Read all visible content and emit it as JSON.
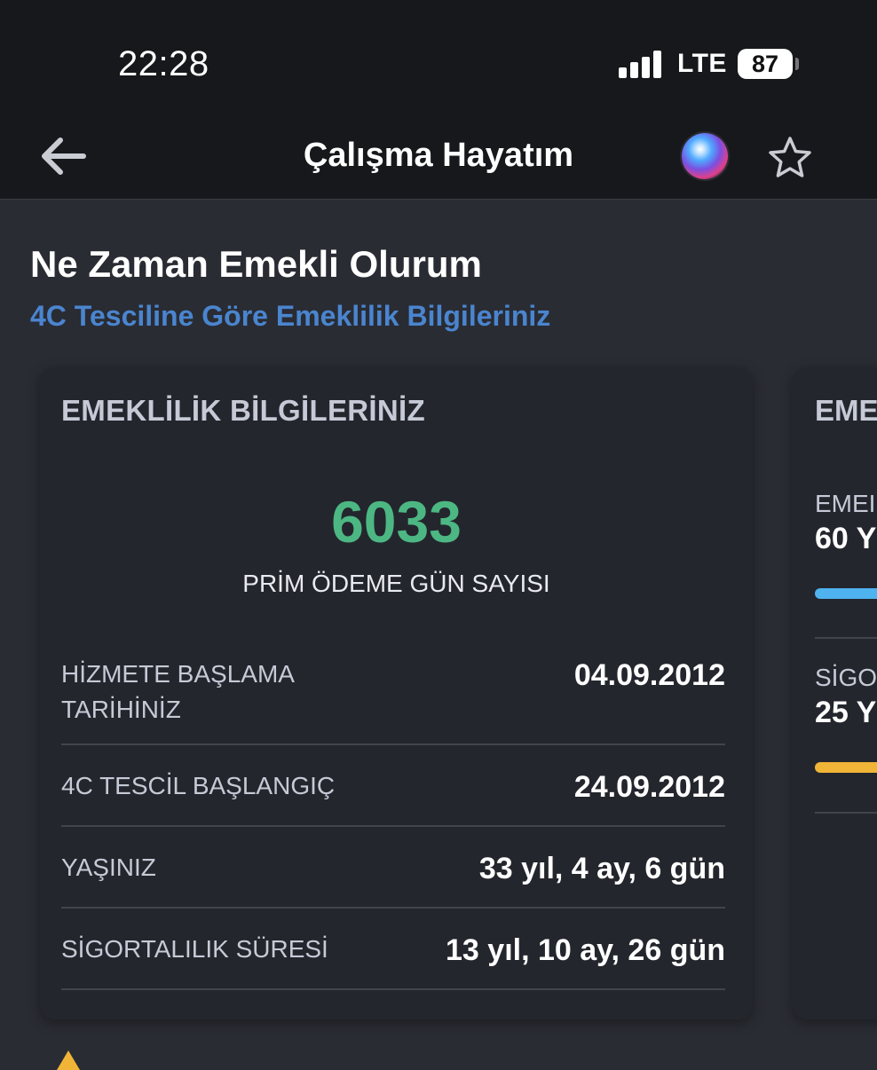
{
  "status": {
    "time": "22:28",
    "network": "LTE",
    "battery": "87"
  },
  "nav": {
    "title": "Çalışma Hayatım"
  },
  "header": {
    "title": "Ne Zaman Emekli Olurum",
    "subtitle": "4C Tesciline Göre Emeklilik Bilgileriniz"
  },
  "card": {
    "title": "EMEKLİLİK BİLGİLERİNİZ",
    "prim_days": "6033",
    "prim_label": "PRİM ÖDEME GÜN SAYISI",
    "rows": [
      {
        "label_line1": "HİZMETE BAŞLAMA",
        "label_line2": "TARİHİNİZ",
        "value": "04.09.2012"
      },
      {
        "label": "4C TESCİL BAŞLANGIÇ",
        "value": "24.09.2012"
      },
      {
        "label": "YAŞINIZ",
        "value": "33 yıl, 4 ay, 6 gün"
      },
      {
        "label": "SİGORTALILIK SÜRESİ",
        "value": "13 yıl, 10 ay, 26 gün"
      }
    ]
  },
  "card2": {
    "title": "EME",
    "item1_label": "EMEI",
    "item1_value": "60 Y",
    "item2_label": "SİGO",
    "item2_value": "25 Y",
    "colors": {
      "bar1": "#4fb3f0",
      "bar2": "#f0b437"
    }
  },
  "colors": {
    "accent_green": "#4cb783",
    "accent_blue": "#4a85cf",
    "warning": "#f0b437"
  }
}
